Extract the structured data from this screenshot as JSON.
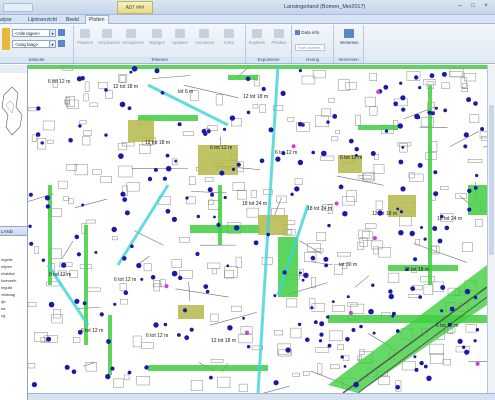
{
  "window": {
    "title": "Lansingerland (Bomen_Mei2017)",
    "contextual_tab": "A07 ###"
  },
  "tabs": [
    {
      "label": "alyse"
    },
    {
      "label": "Lijstoverzicht"
    },
    {
      "label": "Beeld"
    },
    {
      "label": "Plotten"
    }
  ],
  "ribbon": {
    "selectie": {
      "label": "Selectie",
      "layers_combo": "<Alle lagen>",
      "zoom_combo": "<volg laag>"
    },
    "tekenen": {
      "label": "Tekenen",
      "buttons": [
        "Plaatsen",
        "Verplaatsen",
        "Verwijderen",
        "Wijzigen",
        "Updaten",
        "Annoteren",
        "Extra"
      ]
    },
    "exporteren": {
      "label": "Exporteren",
      "buttons": [
        "Kopiëren",
        "Plakken"
      ]
    },
    "overig": {
      "label": "Overig",
      "data_info": "Data info",
      "search_placeholder": "Snel zoeken..."
    },
    "verversen": {
      "label": "Verversen",
      "button": "Verversen"
    }
  },
  "side_panel": {
    "header": "LAND",
    "rows": [
      "regeler",
      "nlijnen",
      "nhabitat",
      "hoeveelh",
      "regulie",
      "veldslag",
      "lijn",
      "ea",
      "ng"
    ]
  },
  "map_labels": [
    "6 tot 12 m",
    "12 tot 18 m",
    "18 tot 24 m",
    "tot 30 m",
    "6 tot 12 m",
    "12 tot 18 m",
    "6 tot 12 m",
    "18 tot 24 m",
    "12 tot 18 m",
    "6 tot 12 m",
    "tot 6 m",
    "6 tot 12 m",
    "12 tot 18 m",
    "6 tot 12 m",
    "6 tot 12 m",
    "12 tot 18 m",
    "6 tot 12 m",
    "18 tot 24 m",
    "6 tot 12 m",
    "12 tot 18 m"
  ],
  "colors": {
    "ribbon_bg": "#dfe8f4",
    "green_area": "#3fce3f",
    "olive_area": "#b5b84a",
    "tree_dot": "#1a1aa6",
    "cyan_path": "#3fd4d4",
    "magenta_mark": "#d23ad2"
  }
}
